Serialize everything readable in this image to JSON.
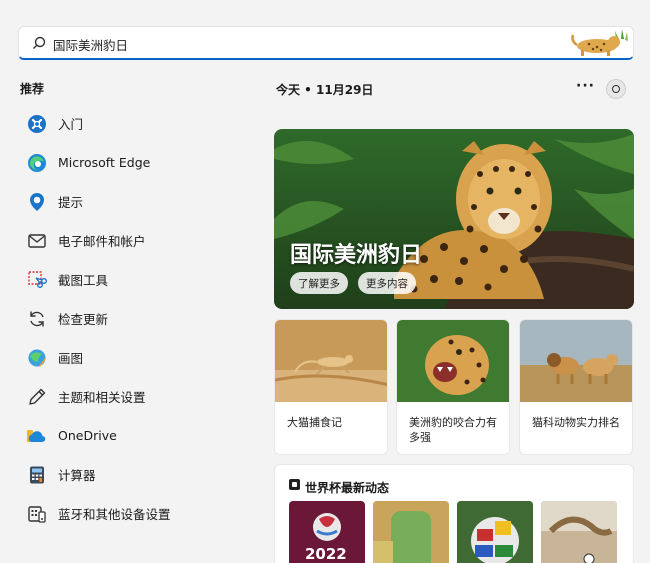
{
  "search": {
    "query": "国际美洲豹日"
  },
  "recommended": {
    "title": "推荐",
    "items": [
      {
        "label": "入门",
        "icon": "get-started-icon"
      },
      {
        "label": "Microsoft Edge",
        "icon": "edge-icon"
      },
      {
        "label": "提示",
        "icon": "tips-icon"
      },
      {
        "label": "电子邮件和帐户",
        "icon": "mail-icon"
      },
      {
        "label": "截图工具",
        "icon": "snipping-tool-icon"
      },
      {
        "label": "检查更新",
        "icon": "update-icon"
      },
      {
        "label": "画图",
        "icon": "paint-icon"
      },
      {
        "label": "主题和相关设置",
        "icon": "pen-icon"
      },
      {
        "label": "OneDrive",
        "icon": "onedrive-icon"
      },
      {
        "label": "计算器",
        "icon": "calculator-icon"
      },
      {
        "label": "蓝牙和其他设备设置",
        "icon": "bluetooth-devices-icon"
      }
    ]
  },
  "feed": {
    "date_label": "今天 • 11月29日",
    "more_label": "···",
    "hero": {
      "title": "国际美洲豹日",
      "learn_more": "了解更多",
      "more_content": "更多内容"
    },
    "cards": [
      {
        "text": "大猫捕食记"
      },
      {
        "text": "美洲豹的咬合力有多强"
      },
      {
        "text": "猫科动物实力排名"
      }
    ],
    "worldcup": {
      "title": "世界杯最新动态",
      "thumb1_text": "2022"
    }
  }
}
